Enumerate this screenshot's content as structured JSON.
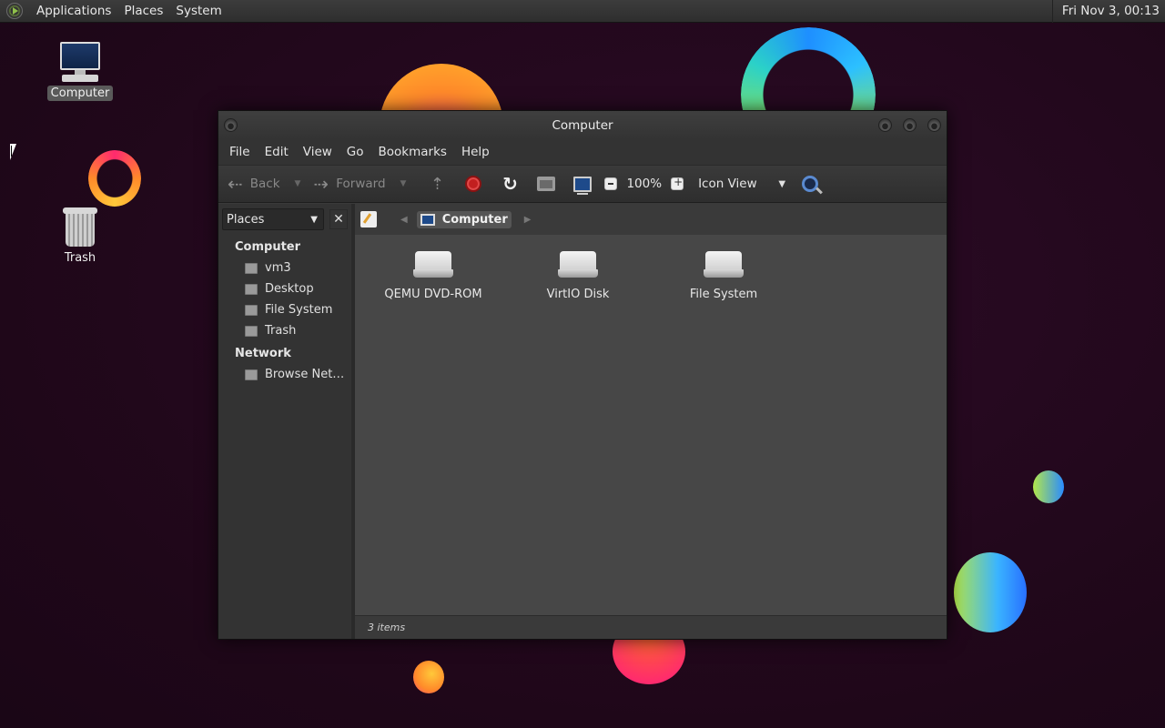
{
  "top_panel": {
    "menus": [
      "Applications",
      "Places",
      "System"
    ],
    "clock": "Fri Nov  3, 00:13"
  },
  "desktop": {
    "icons": [
      {
        "label": "Computer",
        "icon": "computer-icon",
        "selected": true
      },
      {
        "label": "Trash",
        "icon": "trash-icon",
        "selected": false
      }
    ]
  },
  "window": {
    "title": "Computer",
    "menubar": [
      "File",
      "Edit",
      "View",
      "Go",
      "Bookmarks",
      "Help"
    ],
    "toolbar": {
      "back_label": "Back",
      "forward_label": "Forward",
      "zoom_level": "100%",
      "view_mode": "Icon View"
    },
    "sidebar": {
      "selector_label": "Places",
      "sections": [
        {
          "title": "Computer",
          "items": [
            "vm3",
            "Desktop",
            "File System",
            "Trash"
          ]
        },
        {
          "title": "Network",
          "items": [
            "Browse Net…"
          ]
        }
      ]
    },
    "pathbar": {
      "current": "Computer"
    },
    "items": [
      {
        "label": "QEMU DVD-ROM",
        "icon": "optical-drive-icon"
      },
      {
        "label": "VirtIO Disk",
        "icon": "hard-disk-icon"
      },
      {
        "label": "File System",
        "icon": "hard-disk-icon"
      }
    ],
    "status": "3 items"
  },
  "colors": {
    "desktop_bg": "#22091c",
    "window_bg": "#3a3a3a",
    "content_bg": "#474747"
  }
}
